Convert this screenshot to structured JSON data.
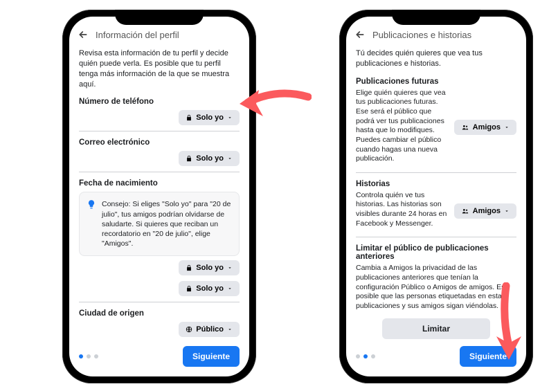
{
  "left": {
    "header_title": "Información del perfil",
    "intro": "Revisa esta información de tu perfil y decide quién puede verla. Es posible que tu perfil tenga más información de la que se muestra aquí.",
    "section_phone_title": "Número de teléfono",
    "phone_audience": "Solo yo",
    "section_email_title": "Correo electrónico",
    "email_audience": "Solo yo",
    "section_birthday_title": "Fecha de nacimiento",
    "tip_text": "Consejo: Si eliges \"Solo yo\" para \"20 de julio\", tus amigos podrían olvidarse de saludarte. Si quieres que reciban un recordatorio en \"20 de julio\", elige \"Amigos\".",
    "birthday_audience_1": "Solo yo",
    "birthday_audience_2": "Solo yo",
    "section_hometown_title": "Ciudad de origen",
    "hometown_audience": "Público",
    "next_label": "Siguiente",
    "progress_active_index": 0,
    "progress_total": 3
  },
  "right": {
    "header_title": "Publicaciones e historias",
    "intro": "Tú decides quién quieres que vea tus publicaciones e historias.",
    "future_title": "Publicaciones futuras",
    "future_desc": "Elige quién quieres que vea tus publicaciones futuras. Ese será el público que podrá ver tus publicaciones hasta que lo modifiques. Puedes cambiar el público cuando hagas una nueva publicación.",
    "future_audience": "Amigos",
    "stories_title": "Historias",
    "stories_desc": "Controla quién ve tus historias. Las historias son visibles durante 24 horas en Facebook y Messenger.",
    "stories_audience": "Amigos",
    "limit_title": "Limitar el público de publicaciones anteriores",
    "limit_desc": "Cambia a Amigos la privacidad de las publicaciones anteriores que tenían la configuración Público o Amigos de amigos. Es posible que las personas etiquetadas en estas publicaciones y sus amigos sigan viéndolas.",
    "limit_button": "Limitar",
    "next_label": "Siguiente",
    "progress_active_index": 1,
    "progress_total": 3
  },
  "colors": {
    "primary_blue": "#1877f2",
    "annotation_arrow": "#fb5a5d"
  }
}
